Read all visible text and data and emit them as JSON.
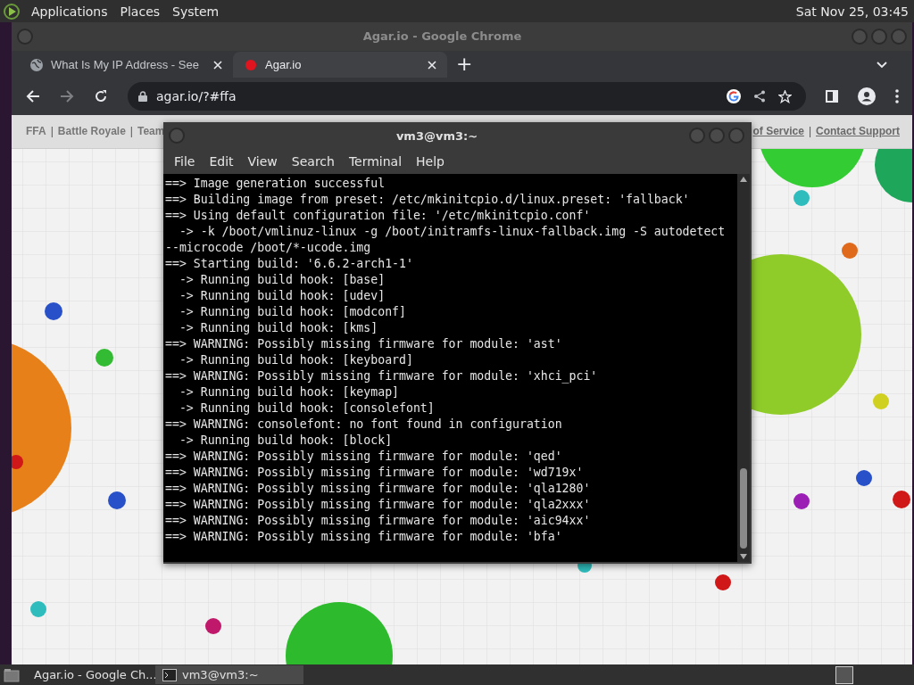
{
  "top_panel": {
    "menus": [
      "Applications",
      "Places",
      "System"
    ],
    "clock": "Sat Nov 25, 03:45"
  },
  "browser": {
    "title": "Agar.io - Google Chrome",
    "tabs": [
      {
        "label": "What Is My IP Address - See",
        "selected": false,
        "kind": "globe"
      },
      {
        "label": "Agar.io",
        "selected": true,
        "kind": "dot"
      }
    ],
    "new_tab": "+",
    "address": "agar.io/?#ffa",
    "nav_left": [
      {
        "kind": "link",
        "text": "FFA"
      },
      {
        "kind": "sep",
        "text": "|"
      },
      {
        "kind": "link",
        "text": "Battle Royale"
      },
      {
        "kind": "sep",
        "text": "|"
      },
      {
        "kind": "link",
        "text": "Team"
      }
    ],
    "nav_right": [
      {
        "kind": "ulink",
        "text": "of Service"
      },
      {
        "kind": "sep",
        "text": "|"
      },
      {
        "kind": "ulink",
        "text": "Contact Support"
      }
    ]
  },
  "terminal": {
    "title": "vm3@vm3:~",
    "menu": [
      "File",
      "Edit",
      "View",
      "Search",
      "Terminal",
      "Help"
    ],
    "lines": [
      "==> Image generation successful",
      "==> Building image from preset: /etc/mkinitcpio.d/linux.preset: 'fallback'",
      "==> Using default configuration file: '/etc/mkinitcpio.conf'",
      "  -> -k /boot/vmlinuz-linux -g /boot/initramfs-linux-fallback.img -S autodetect",
      "--microcode /boot/*-ucode.img",
      "==> Starting build: '6.6.2-arch1-1'",
      "  -> Running build hook: [base]",
      "  -> Running build hook: [udev]",
      "  -> Running build hook: [modconf]",
      "  -> Running build hook: [kms]",
      "==> WARNING: Possibly missing firmware for module: 'ast'",
      "  -> Running build hook: [keyboard]",
      "==> WARNING: Possibly missing firmware for module: 'xhci_pci'",
      "  -> Running build hook: [keymap]",
      "  -> Running build hook: [consolefont]",
      "==> WARNING: consolefont: no font found in configuration",
      "  -> Running build hook: [block]",
      "==> WARNING: Possibly missing firmware for module: 'qed'",
      "==> WARNING: Possibly missing firmware for module: 'wd719x'",
      "==> WARNING: Possibly missing firmware for module: 'qla1280'",
      "==> WARNING: Possibly missing firmware for module: 'qla2xxx'",
      "==> WARNING: Possibly missing firmware for module: 'aic94xx'",
      "==> WARNING: Possibly missing firmware for module: 'bfa'"
    ]
  },
  "taskbar": {
    "items": [
      {
        "label": "Agar.io - Google Ch...",
        "selected": false,
        "kind": "chrome"
      },
      {
        "label": "vm3@vm3:~",
        "selected": true,
        "kind": "terminal"
      }
    ]
  }
}
